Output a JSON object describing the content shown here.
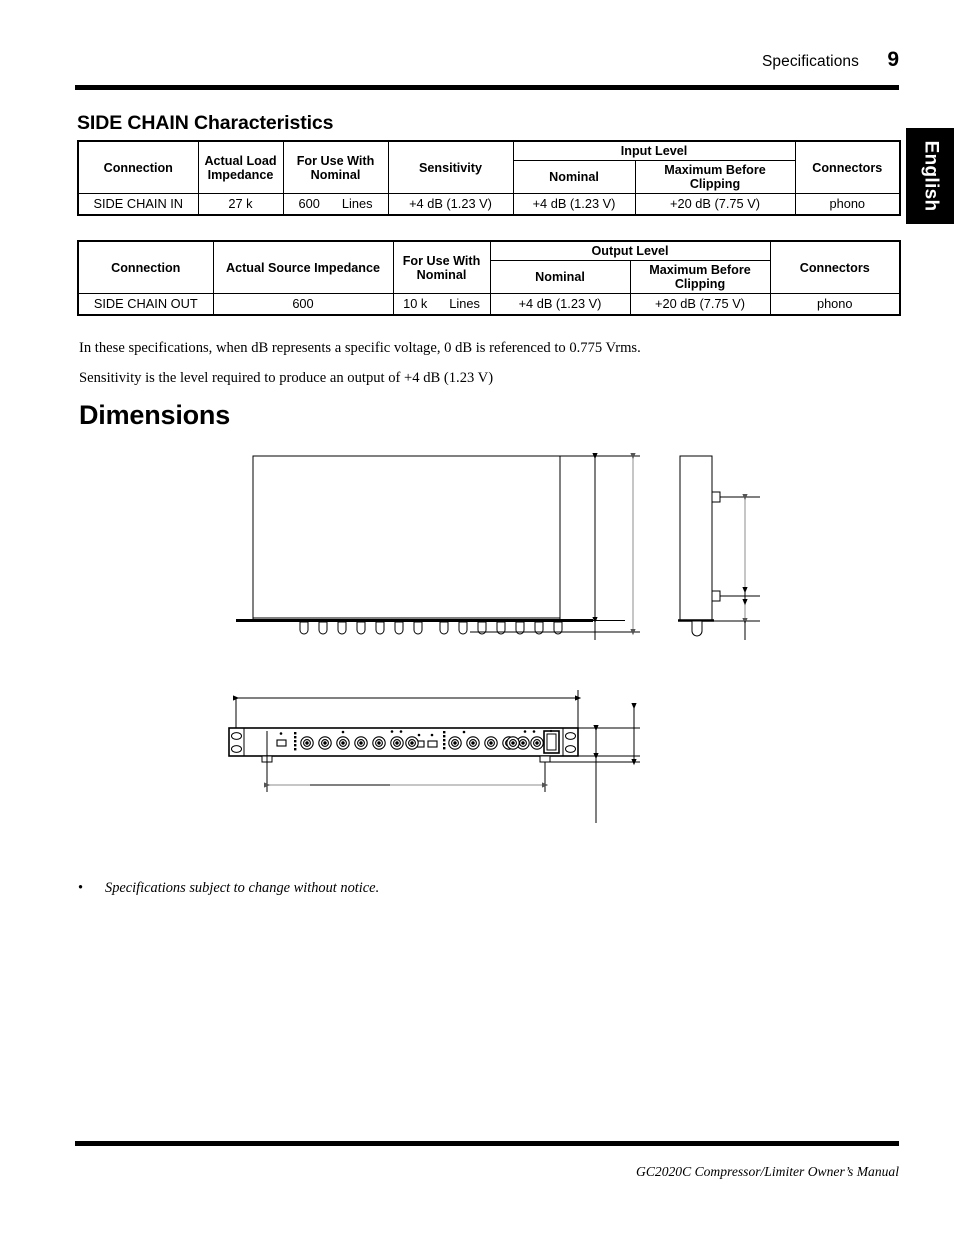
{
  "header": {
    "section": "Specifications",
    "page_number": "9"
  },
  "language_tab": {
    "label": "English"
  },
  "section_title": "SIDE CHAIN Characteristics",
  "table_input": {
    "group_header": "Input Level",
    "columns": [
      "Connection",
      "Actual Load Impedance",
      "For Use With Nominal",
      "Sensitivity",
      "Nominal",
      "Maximum Before Clipping",
      "Connectors"
    ],
    "rows": [
      {
        "connection": "SIDE CHAIN IN",
        "actual_impedance": "27 k",
        "for_use_with_value": "600",
        "for_use_with_unit": "Lines",
        "sensitivity": "+4 dB (1.23 V)",
        "nominal": "+4 dB (1.23 V)",
        "max_before_clipping": "+20 dB (7.75 V)",
        "connectors": "phono"
      }
    ]
  },
  "table_output": {
    "group_header": "Output Level",
    "columns": [
      "Connection",
      "Actual Source Impedance",
      "For Use With Nominal",
      "Nominal",
      "Maximum Before Clipping",
      "Connectors"
    ],
    "rows": [
      {
        "connection": "SIDE CHAIN OUT",
        "actual_impedance": "600",
        "for_use_with_value": "10 k",
        "for_use_with_unit": "Lines",
        "nominal": "+4 dB (1.23 V)",
        "max_before_clipping": "+20 dB (7.75 V)",
        "connectors": "phono"
      }
    ]
  },
  "notes": {
    "note1": "In these specifications, when dB represents a specific voltage, 0 dB is referenced to 0.775 Vrms.",
    "note2": "Sensitivity is the level required to produce an output of +4 dB (1.23 V)"
  },
  "dimensions_heading": "Dimensions",
  "bullet_note": {
    "marker": "•",
    "text": "Specifications subject to change without notice."
  },
  "footer": {
    "text": "GC2020C Compressor/Limiter Owner’s Manual"
  },
  "colors": {
    "ink": "#000000",
    "paper": "#ffffff",
    "dim_line_gray": "#8c8c8c"
  }
}
